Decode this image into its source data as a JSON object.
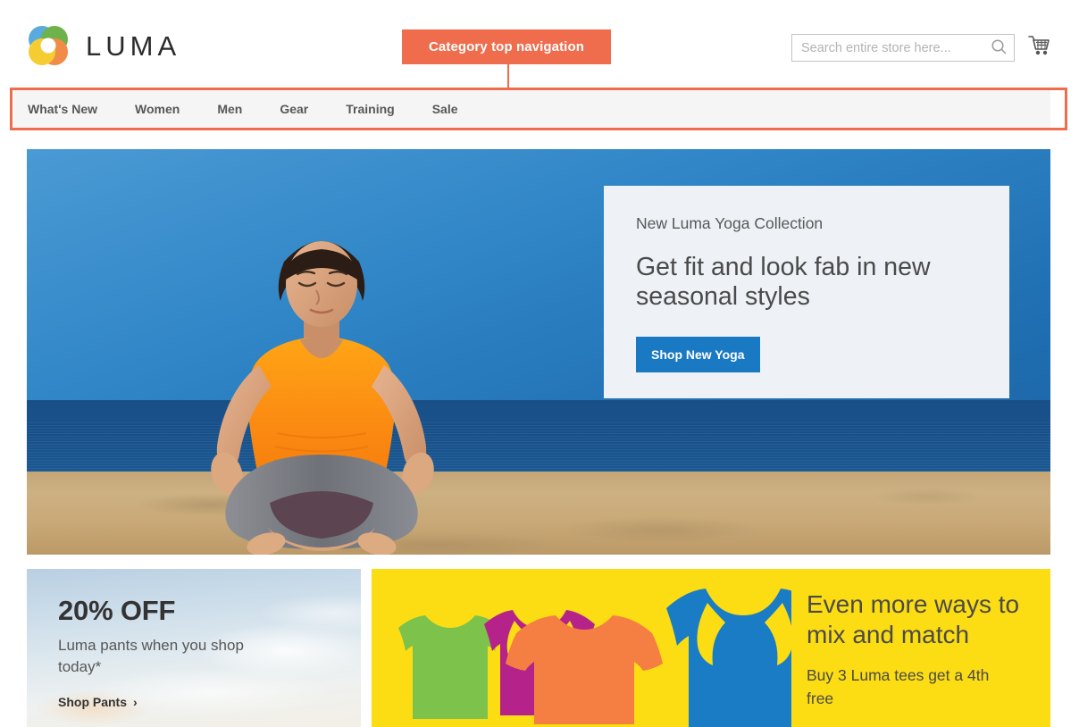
{
  "header": {
    "logo_text": "LUMA",
    "logo_icon": "luma-rings-logo",
    "search": {
      "placeholder": "Search entire store here...",
      "value": "",
      "icon": "search-icon"
    },
    "cart": {
      "icon": "shopping-cart-icon"
    }
  },
  "annotation": {
    "label": "Category top navigation",
    "color": "#ef6c4d"
  },
  "nav": {
    "items": [
      {
        "label": "What's New"
      },
      {
        "label": "Women"
      },
      {
        "label": "Men"
      },
      {
        "label": "Gear"
      },
      {
        "label": "Training"
      },
      {
        "label": "Sale"
      }
    ]
  },
  "hero": {
    "eyebrow": "New Luma Yoga Collection",
    "title": "Get fit and look fab in new seasonal styles",
    "cta_label": "Shop New Yoga",
    "cta_color": "#1979c3",
    "panel_color": "#eef2f7",
    "image_alt": "woman meditating on beach"
  },
  "promos": [
    {
      "headline": "20% OFF",
      "sub": "Luma pants when you shop today*",
      "link_label": "Shop Pants",
      "link_chevron": "›",
      "background": "sky-clouds"
    },
    {
      "title": "Even more ways to mix and match",
      "sub": "Buy 3 Luma tees get a 4th free",
      "background_color": "#fcdd13",
      "shirt_colors": [
        "#7dc24b",
        "#b5238a",
        "#f57e43",
        "#1a7cc4"
      ]
    }
  ]
}
